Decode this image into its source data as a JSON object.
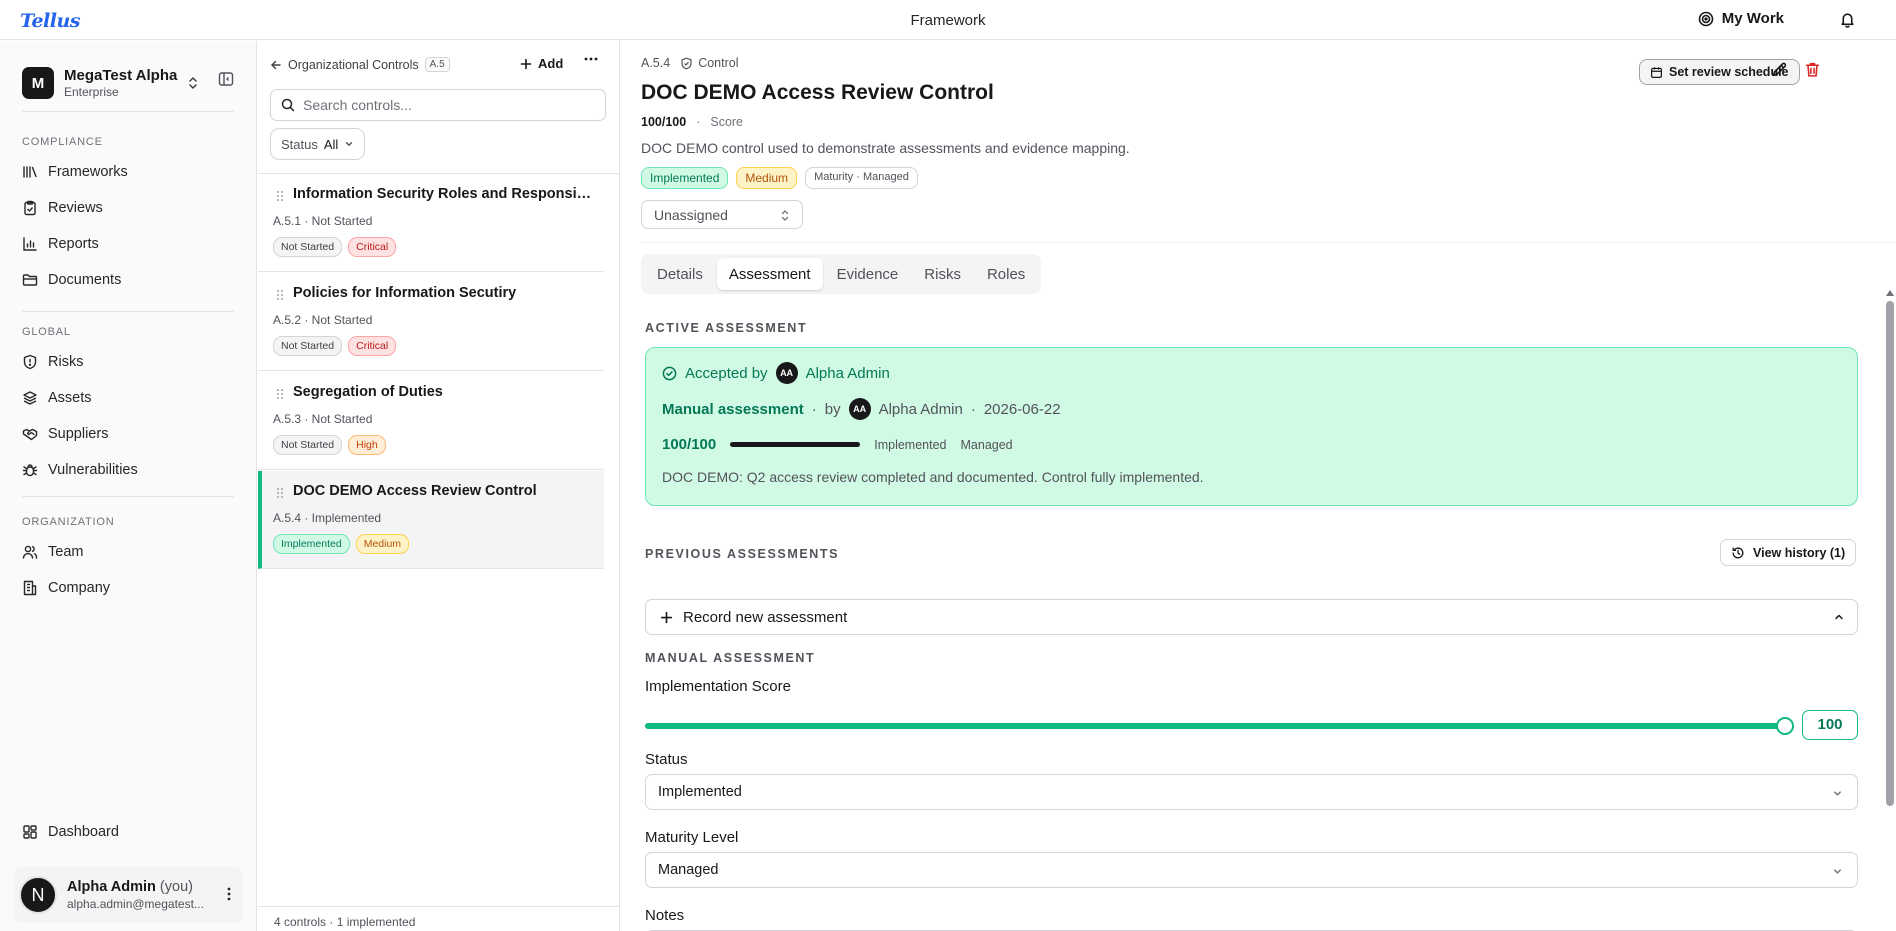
{
  "app": {
    "logo": "Tellus",
    "page_title": "Framework",
    "my_work_label": "My Work"
  },
  "sidebar": {
    "org_initial": "M",
    "org_name": "MegaTest Alpha",
    "org_plan": "Enterprise",
    "sections": {
      "compliance": "COMPLIANCE",
      "global": "GLOBAL",
      "organization": "ORGANIZATION"
    },
    "compliance_items": [
      {
        "label": "Frameworks",
        "icon": "frameworks-icon"
      },
      {
        "label": "Reviews",
        "icon": "clipboard-check-icon"
      },
      {
        "label": "Reports",
        "icon": "bar-chart-icon"
      },
      {
        "label": "Documents",
        "icon": "folder-icon"
      }
    ],
    "global_items": [
      {
        "label": "Risks",
        "icon": "shield-icon"
      },
      {
        "label": "Assets",
        "icon": "layers-icon"
      },
      {
        "label": "Suppliers",
        "icon": "handshake-icon"
      },
      {
        "label": "Vulnerabilities",
        "icon": "bug-icon"
      }
    ],
    "organization_items": [
      {
        "label": "Team",
        "icon": "users-icon"
      },
      {
        "label": "Company",
        "icon": "building-icon"
      }
    ],
    "dashboard_label": "Dashboard",
    "user": {
      "initial": "N",
      "name": "Alpha Admin",
      "you": "(you)",
      "email": "alpha.admin@megatest..."
    }
  },
  "list": {
    "back_label": "Organizational Controls",
    "back_code": "A.5",
    "add_label": "Add",
    "search_placeholder": "Search controls...",
    "filter_label": "Status",
    "filter_value": "All",
    "items": [
      {
        "title": "Information Security Roles and Responsib...",
        "meta": "A.5.1 · Not Started",
        "tags": [
          {
            "label": "Not Started",
            "kind": "notstarted"
          },
          {
            "label": "Critical",
            "kind": "critical"
          }
        ]
      },
      {
        "title": "Policies for Information Secutiry",
        "meta": "A.5.2 · Not Started",
        "tags": [
          {
            "label": "Not Started",
            "kind": "notstarted"
          },
          {
            "label": "Critical",
            "kind": "critical"
          }
        ]
      },
      {
        "title": "Segregation of Duties",
        "meta": "A.5.3 · Not Started",
        "tags": [
          {
            "label": "Not Started",
            "kind": "notstarted"
          },
          {
            "label": "High",
            "kind": "high"
          }
        ]
      },
      {
        "title": "DOC DEMO Access Review Control",
        "meta": "A.5.4 · Implemented",
        "tags": [
          {
            "label": "Implemented",
            "kind": "implemented"
          },
          {
            "label": "Medium",
            "kind": "medium"
          }
        ]
      }
    ],
    "footer": "4 controls · 1 implemented"
  },
  "detail": {
    "code": "A.5.4",
    "type_label": "Control",
    "title": "DOC DEMO Access Review Control",
    "score": "100/100",
    "score_label": "Score",
    "description": "DOC DEMO control used to demonstrate assessments and evidence mapping.",
    "tags": {
      "status": "Implemented",
      "priority": "Medium",
      "maturity": "Maturity · Managed"
    },
    "assignee": "Unassigned",
    "review_button": "Set review schedule",
    "tabs": [
      "Details",
      "Assessment",
      "Evidence",
      "Risks",
      "Roles"
    ],
    "active_tab": "Assessment",
    "active_assessment": {
      "section_label": "ACTIVE ASSESSMENT",
      "accepted_label": "Accepted by",
      "accepted_initials": "AA",
      "accepted_by": "Alpha Admin",
      "method": "Manual assessment",
      "by_label": "by",
      "assessor_initials": "AA",
      "assessor": "Alpha Admin",
      "date": "2026-06-22",
      "score": "100/100",
      "progress_fraction": 1.0,
      "status": "Implemented",
      "maturity": "Managed",
      "note": "DOC DEMO: Q2 access review completed and documented. Control fully implemented."
    },
    "previous_label": "PREVIOUS ASSESSMENTS",
    "history_button": "View history (1)",
    "record_label": "Record new assessment",
    "manual_label": "MANUAL ASSESSMENT",
    "implementation_score_label": "Implementation Score",
    "implementation_score_value": "100",
    "slider_fraction": 1.0,
    "status_label": "Status",
    "status_value": "Implemented",
    "maturity_label": "Maturity Level",
    "maturity_value": "Managed",
    "notes_label": "Notes"
  }
}
